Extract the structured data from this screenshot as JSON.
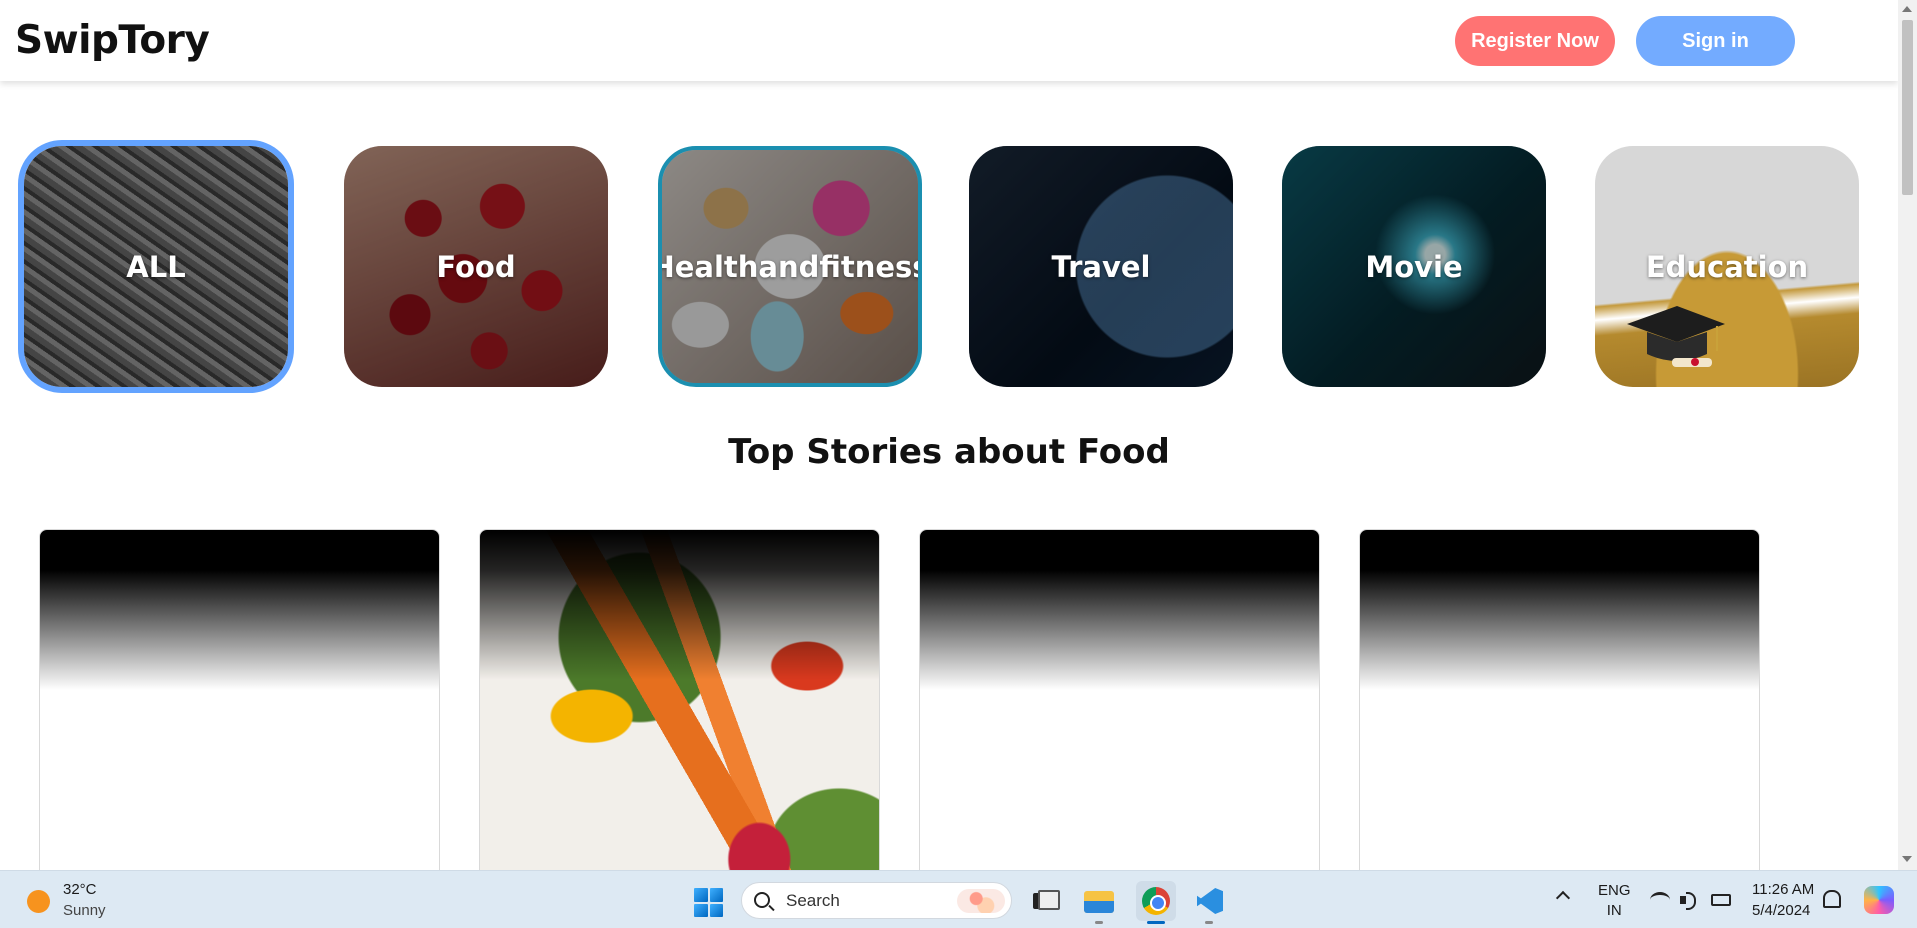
{
  "app": {
    "logo": "SwipTory",
    "register_label": "Register Now",
    "signin_label": "Sign in"
  },
  "categories": [
    {
      "label": "ALL",
      "selected": true
    },
    {
      "label": "Food",
      "selected": false
    },
    {
      "label": "Healthandfitness",
      "selected": false
    },
    {
      "label": "Travel",
      "selected": false
    },
    {
      "label": "Movie",
      "selected": false
    },
    {
      "label": "Education",
      "selected": false
    }
  ],
  "section": {
    "heading": "Top Stories about Food"
  },
  "colors": {
    "register": "#ff7373",
    "signin": "#73abff",
    "selected_outline": "#63a3ff"
  },
  "taskbar": {
    "weather_temp": "32°C",
    "weather_condition": "Sunny",
    "search_label": "Search",
    "language_line1": "ENG",
    "language_line2": "IN",
    "time": "11:26 AM",
    "date": "5/4/2024",
    "apps": [
      "windows-start-icon",
      "task-view-icon",
      "file-explorer-icon",
      "chrome-icon",
      "vscode-icon"
    ]
  }
}
